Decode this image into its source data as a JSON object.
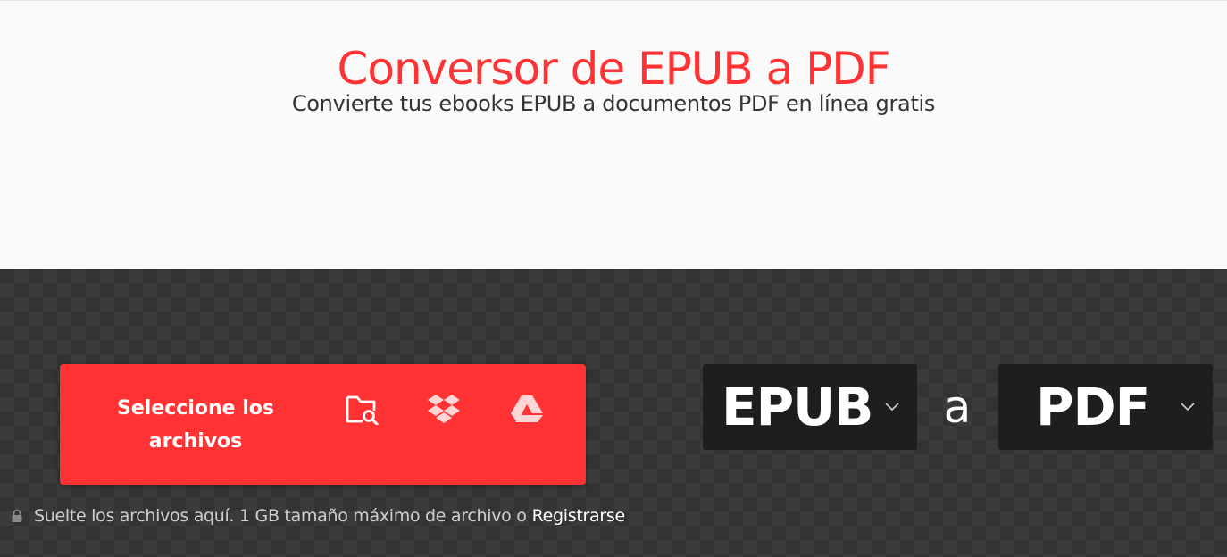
{
  "hero": {
    "title": "Conversor de EPUB a PDF",
    "subtitle": "Convierte tus ebooks EPUB a documentos PDF en línea gratis"
  },
  "upload": {
    "select_label": "Seleccione los archivos",
    "sources": [
      {
        "icon": "folder-search-icon"
      },
      {
        "icon": "dropbox-icon"
      },
      {
        "icon": "google-drive-icon"
      }
    ]
  },
  "converter": {
    "from_format": "EPUB",
    "connector": "a",
    "to_format": "PDF"
  },
  "note": {
    "text": "Suelte los archivos aquí. 1 GB tamaño máximo de archivo o",
    "register_link": "Registrarse"
  },
  "colors": {
    "accent": "#ff3333",
    "dark_bg": "#333333",
    "format_box": "#1e1e1e",
    "hero_bg": "#fafafa"
  }
}
